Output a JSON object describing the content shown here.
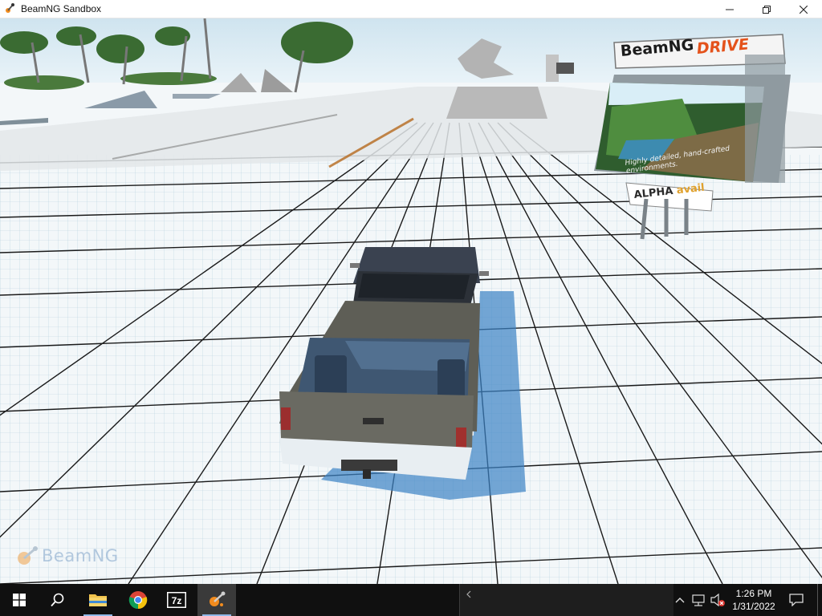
{
  "window": {
    "title": "BeamNG Sandbox",
    "controls": [
      "minimize",
      "maximize",
      "close"
    ]
  },
  "viewport": {
    "watermark": "BeamNG",
    "billboard": {
      "brand_left": "BeamNG",
      "brand_right": "DRIVE",
      "caption": "Highly detailed, hand-crafted environments.",
      "banner_prefix": "ALPHA",
      "banner_suffix": "avail"
    }
  },
  "taskbar": {
    "pinned": [
      {
        "name": "start",
        "icon": "windows-logo-icon"
      },
      {
        "name": "search",
        "icon": "search-icon"
      },
      {
        "name": "file-explorer",
        "icon": "folder-icon"
      },
      {
        "name": "chrome",
        "icon": "chrome-icon"
      },
      {
        "name": "7-zip",
        "icon": "7zip-icon",
        "label": "7z"
      },
      {
        "name": "beamng",
        "icon": "beamng-icon",
        "active": true
      }
    ],
    "preview_text": "",
    "tray": {
      "time": "1:26 PM",
      "date": "1/31/2022"
    }
  },
  "colors": {
    "taskbar": "#101010",
    "accent": "#8fb8e8",
    "billboard_orange": "#e4521b"
  }
}
